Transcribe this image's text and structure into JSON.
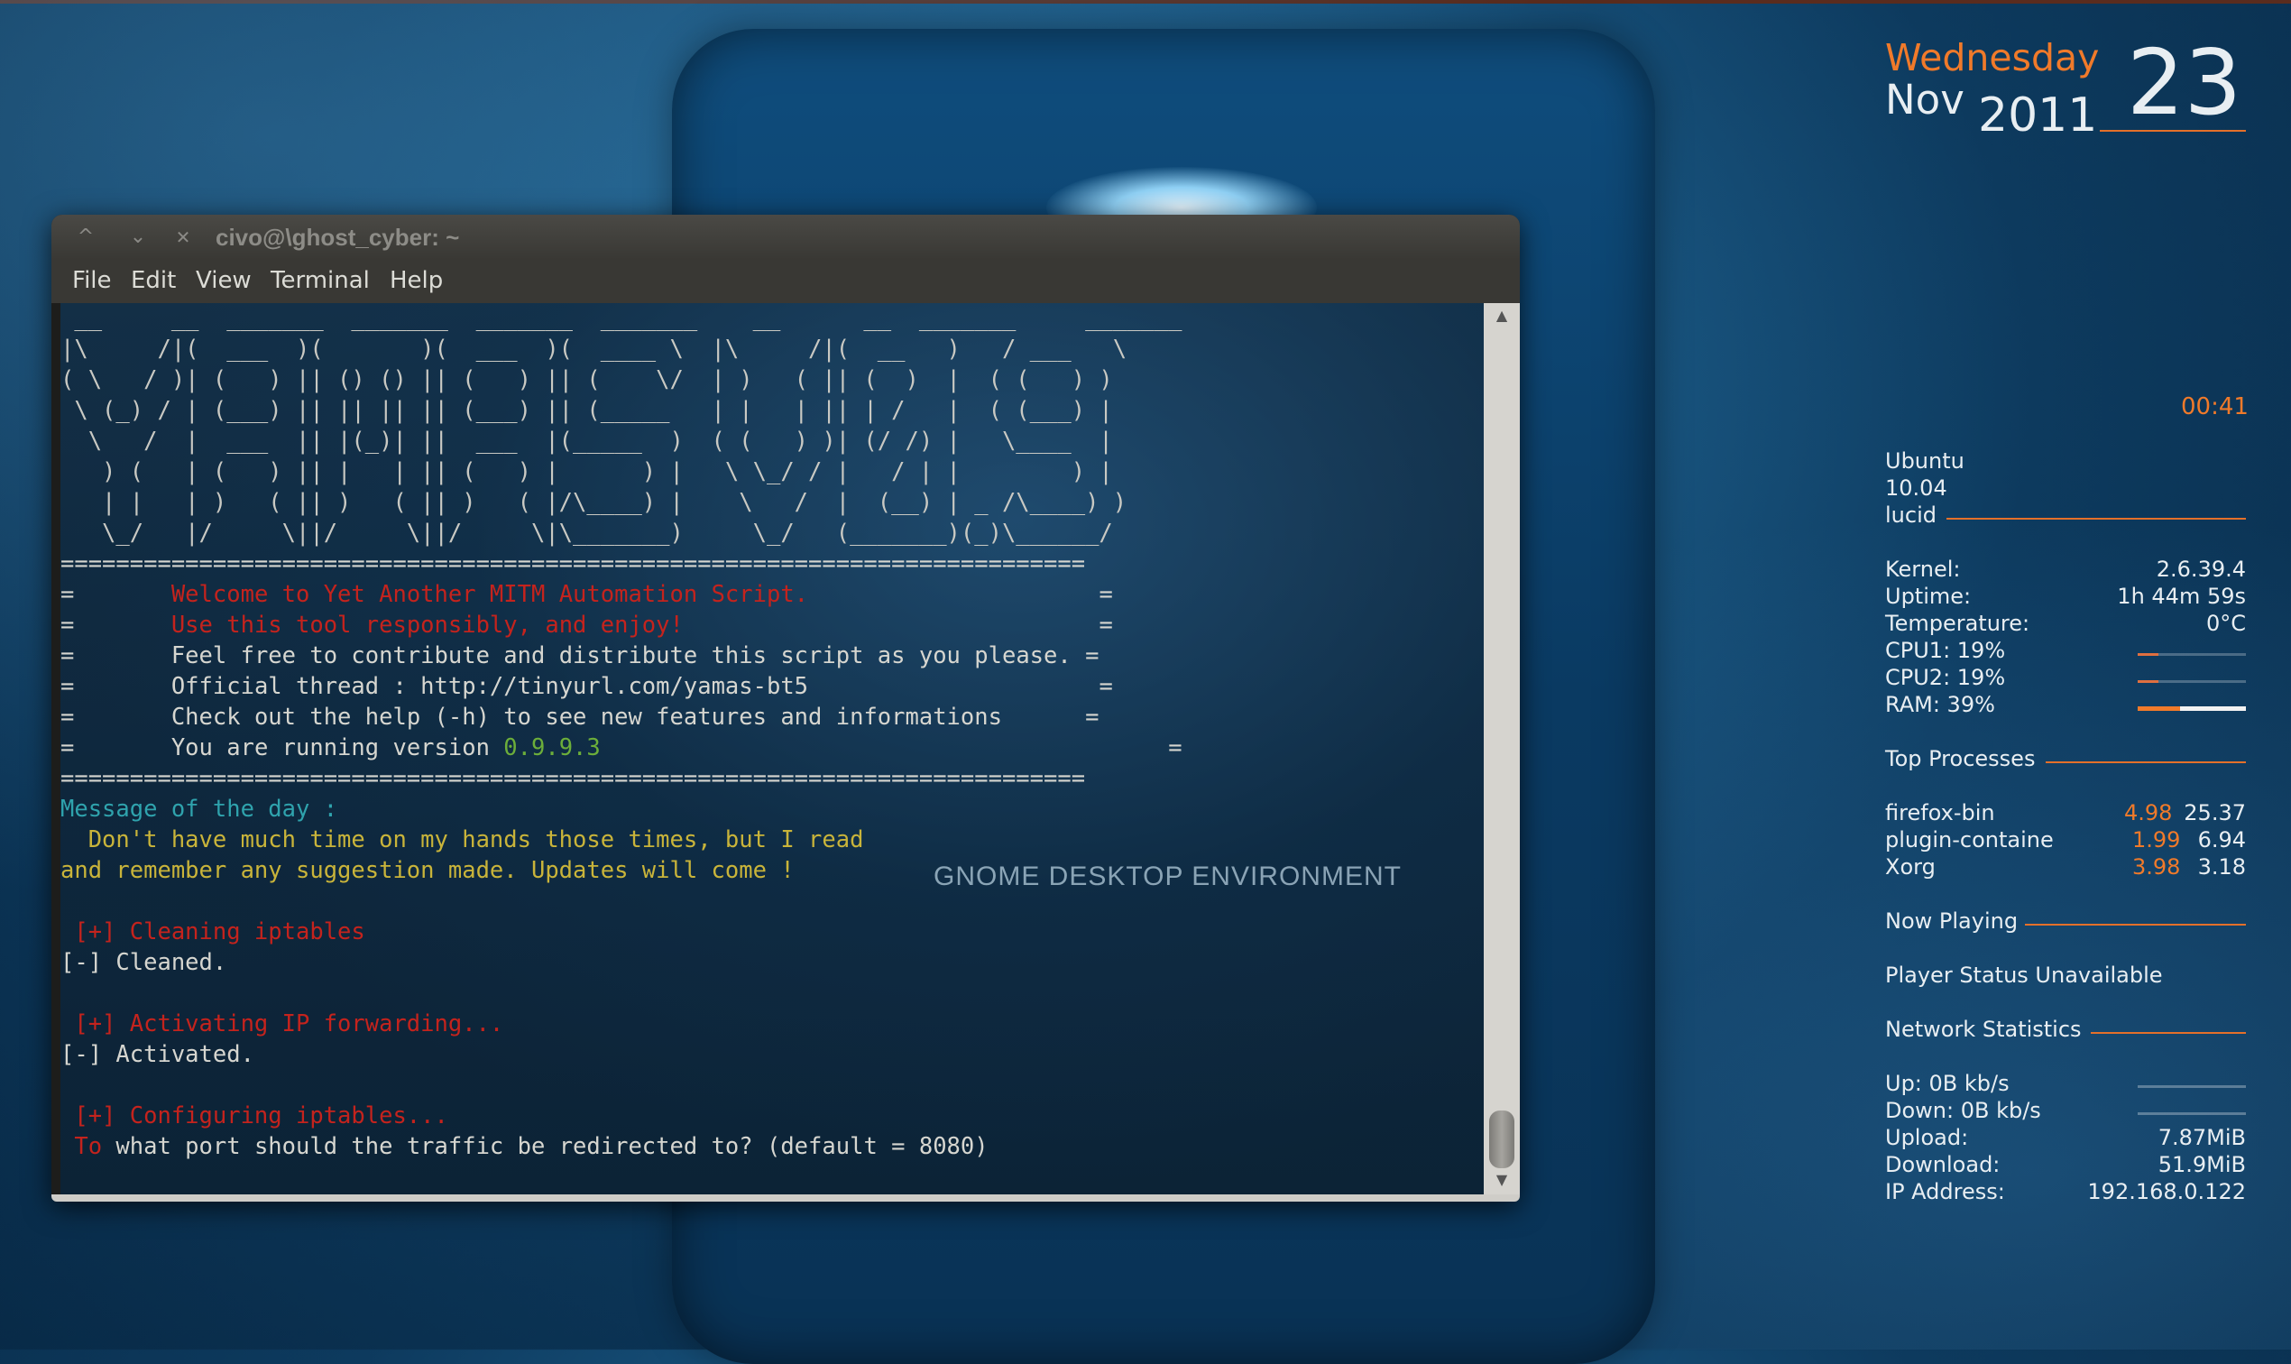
{
  "desktop": {
    "wallpaper_text": "GNOME DESKTOP ENVIRONMENT"
  },
  "terminal": {
    "window_title": "civo@\\ghost_cyber: ~",
    "buttons": {
      "minimize": "^",
      "maximize": "⌄",
      "close": "✕"
    },
    "menu": [
      "File",
      "Edit",
      "View",
      "Terminal",
      "Help"
    ],
    "ascii_banner": [
      " __     __  _______  _______  _______  _______    __      __  _______     _______ ",
      "|\\     /|(  ___  )(       )(  ___  )(  ____ \\  |\\     /|(  __   )   / ___   \\",
      "( \\   / )| (   ) || () () || (   ) || (    \\/  | )   ( || (  )  |  ( (   ) )",
      " \\ (_) / | (___) || || || || (___) || (_____   | |   | || | /   |  ( (___) |",
      "  \\   /  |  ___  || |(_)| ||  ___  |(_____  )  ( (   ) )| (/ /) |   \\____  |",
      "   ) (   | (   ) || |   | || (   ) |      ) |   \\ \\_/ / |   / | |        ) |",
      "   | |   | )   ( || )   ( || )   ( |/\\____) |    \\   /  |  (__) | _ /\\____) )",
      "   \\_/   |/     \\||/     \\||/     \\|\\_______)     \\_/   (_______)(_)\\______/ "
    ],
    "separator": "==========================================================================",
    "banner_lines": [
      {
        "prefix": "=       ",
        "text": "Welcome to Yet Another MITM Automation Script.",
        "color": "red",
        "pad": "                     ="
      },
      {
        "prefix": "=       ",
        "text": "Use this tool responsibly, and enjoy!",
        "color": "red",
        "pad": "                              ="
      },
      {
        "prefix": "=       ",
        "text": "Feel free to contribute and distribute this script as you please.",
        "color": "plain",
        "pad": " ="
      },
      {
        "prefix": "=       ",
        "text": "Official thread : http://tinyurl.com/yamas-bt5",
        "color": "plain",
        "pad": "                     ="
      },
      {
        "prefix": "=       ",
        "text": "Check out the help (-h) to see new features and informations",
        "color": "plain",
        "pad": "      ="
      }
    ],
    "version_prefix": "You are running version ",
    "version": "0.9.9.3",
    "motd_label": "Message of the day :",
    "motd_line1": "  Don't have much time on my hands those times, but I read",
    "motd_line2": "and remember any suggestion made. Updates will come !",
    "step1": " [+] Cleaning iptables",
    "step1_done": "[-] Cleaned.",
    "step2": " [+] Activating IP forwarding...",
    "step2_done": "[-] Activated.",
    "step3": " [+] Configuring iptables...",
    "prompt_to": " To",
    "prompt_rest": " what port should the traffic be redirected to? (default = 8080)"
  },
  "clock": {
    "weekday": "Wednesday",
    "month": "Nov",
    "year": "2011",
    "day": "23",
    "time": "00:41"
  },
  "sysinfo": {
    "distro": "Ubuntu",
    "release": "10.04",
    "codename": "lucid",
    "rows": [
      {
        "label": "Kernel:",
        "value": "2.6.39.4"
      },
      {
        "label": "Uptime:",
        "value": "1h 44m 59s"
      },
      {
        "label": "Temperature:",
        "value": "0°C"
      }
    ],
    "cpu1": "CPU1: 19%",
    "cpu2": "CPU2: 19%",
    "ram": "RAM: 39%",
    "cpu1_level": 0.19,
    "cpu2_level": 0.19,
    "ram_level": 0.39
  },
  "top_processes": {
    "header": "Top Processes",
    "items": [
      {
        "name": "firefox-bin",
        "cpu": "4.98",
        "mem": "25.37"
      },
      {
        "name": "plugin-containe",
        "cpu": "1.99",
        "mem": "6.94"
      },
      {
        "name": "Xorg",
        "cpu": "3.98",
        "mem": "3.18"
      }
    ]
  },
  "now_playing": {
    "header": "Now Playing",
    "status": "Player Status Unavailable"
  },
  "network": {
    "header": "Network Statistics",
    "up": "Up: 0B   kb/s",
    "down": "Down: 0B   kb/s",
    "rows": [
      {
        "label": "Upload:",
        "value": "7.87MiB"
      },
      {
        "label": "Download:",
        "value": "51.9MiB"
      },
      {
        "label": "IP Address:",
        "value": "192.168.0.122"
      }
    ]
  },
  "colors": {
    "accent": "#f07a2a",
    "term_red": "#c4231d",
    "term_yellow": "#c9b43a",
    "term_cyan": "#2fa3ad",
    "term_green": "#6cae3a"
  }
}
